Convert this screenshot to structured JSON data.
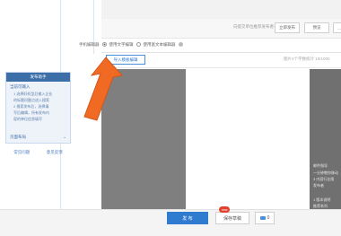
{
  "topbar": {
    "hint": "向提交单位推荐发布者一键。",
    "buttons": [
      "立即发布",
      "预览",
      "..."
    ]
  },
  "editor_mode": {
    "label": "手机编辑器",
    "options": [
      {
        "label": "使用文字编辑",
        "selected": true
      },
      {
        "label": "使用富文本编辑器",
        "selected": false
      }
    ]
  },
  "editor": {
    "import_label": "导入模板编辑",
    "word_count": "图片4个字数统计 10/1000"
  },
  "help_panel": {
    "header": "发布助手",
    "title": "当前可输入",
    "lines": [
      "1 选择好机型后输入企业",
      "的标题问题点进入搜索",
      "2 搜索发布后，选择填",
      "写后编辑，所有发布内",
      "容的单位信息填写"
    ],
    "footer_label": "页面布局",
    "links": [
      "常见问题",
      "意见反馈"
    ]
  },
  "right_side": {
    "lines": [
      "邮件指导",
      "一分钟教你移动",
      "3 内容行业版",
      "发布者",
      "1 版本说明",
      "推荐系列"
    ]
  },
  "bottom": {
    "publish_label": "发 布",
    "draft_label": "保存草稿",
    "draft_badge": "new",
    "comment_count": "0"
  },
  "colors": {
    "accent": "#2f7bd0",
    "arrow": "#f06a23",
    "canvas_grey": "#7f7f7f"
  }
}
